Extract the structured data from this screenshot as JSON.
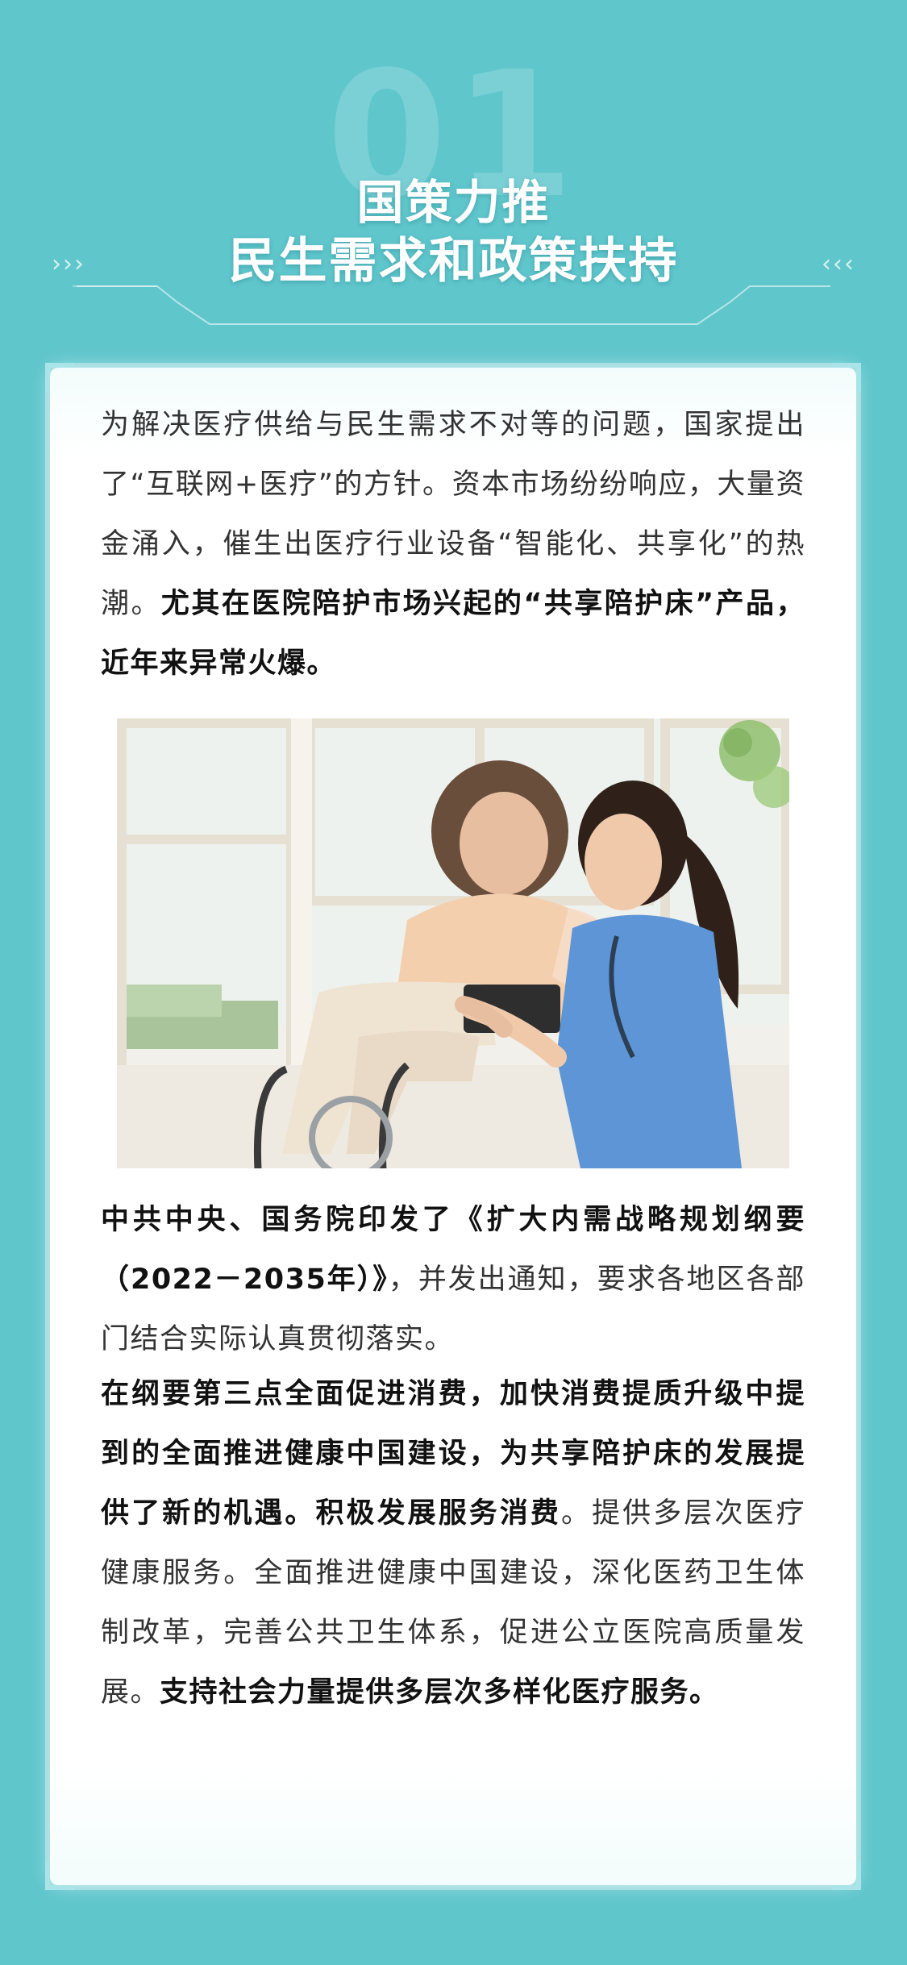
{
  "header": {
    "number": "01",
    "title_line1": "国策力推",
    "title_line2": "民生需求和政策扶持",
    "chevrons_left": "›››",
    "chevrons_right": "‹‹‹"
  },
  "article": {
    "p1": [
      {
        "text": "为解决医疗供给与民生需求不对等的问题，国家提出了“互联网+医疗”的方针。资本市场纷纷响应，大量资金涌入，催生出医疗行业设备“智能化、共享化”的热潮。",
        "bold": false
      },
      {
        "text": "尤其在医院陪护市场兴起的“共享陪护床”产品，近年来异常火爆。",
        "bold": true
      }
    ],
    "p2": [
      {
        "text": "中共中央、国务院印发了《扩大内需战略规划纲要（2022－2035年）》",
        "bold": true
      },
      {
        "text": "，并发出通知，要求各地区各部门结合实际认真贯彻落实。",
        "bold": false
      }
    ],
    "p3": [
      {
        "text": "在纲要第三点全面促进消费，加快消费提质升级中提到的全面推进健康中国建设，为共享陪护床的发展提供了新的机遇。积极发展服务消费",
        "bold": true
      },
      {
        "text": "。提供多层次医疗健康服务。全面推进健康中国建设，深化医药卫生体制改革，完善公共卫生体系，促进公立医院高质量发展。",
        "bold": false
      },
      {
        "text": "支持社会力量提供多层次多样化医疗服务。",
        "bold": true
      }
    ]
  },
  "photo": {
    "subject": "nurse-with-elderly-woman-in-wheelchair",
    "colors": {
      "window": "#eef2ee",
      "frame": "#f4f1ea",
      "scrubs": "#5d95d6",
      "blouse": "#f3cfae",
      "trousers": "#efe3d2",
      "plants": "#8fbf6f"
    }
  },
  "theme": {
    "background": "#5fc6cc",
    "card": "#ffffff",
    "text": "#333333",
    "bold_text": "#111111"
  }
}
